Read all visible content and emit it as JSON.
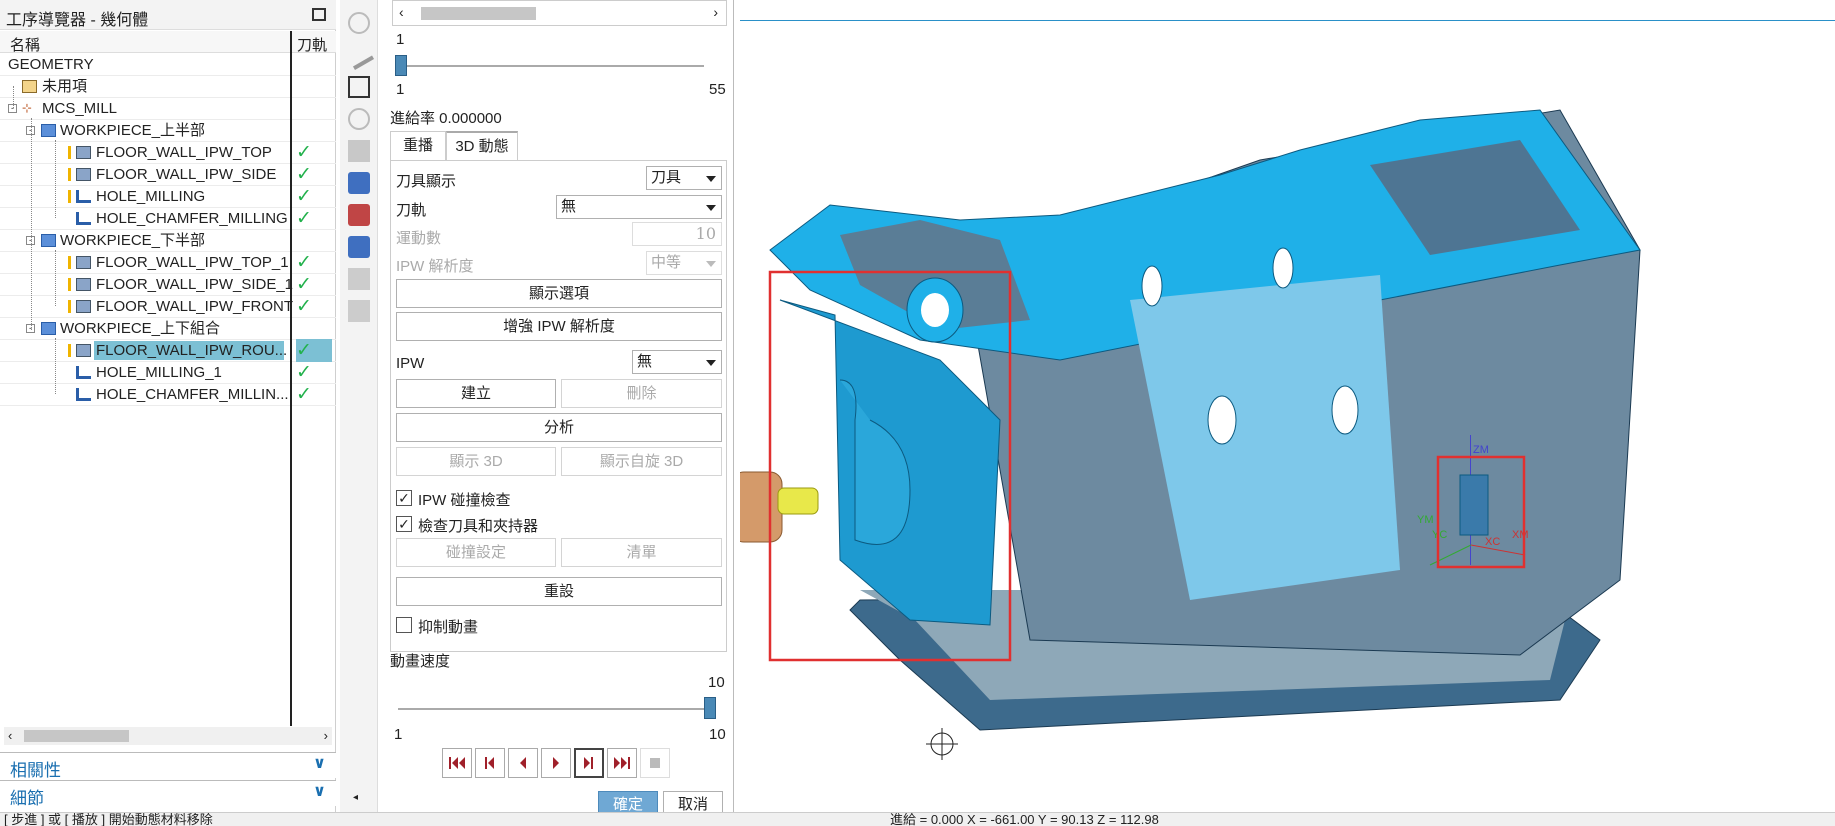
{
  "navigator": {
    "title": "工序導覽器 - 幾何體",
    "col_name": "名稱",
    "col_path": "刀軌",
    "rows": [
      {
        "label": "GEOMETRY",
        "check": ""
      },
      {
        "label": "未用項",
        "check": ""
      },
      {
        "label": "MCS_MILL",
        "check": ""
      },
      {
        "label": "WORKPIECE_上半部",
        "check": ""
      },
      {
        "label": "FLOOR_WALL_IPW_TOP",
        "check": "✓"
      },
      {
        "label": "FLOOR_WALL_IPW_SIDE",
        "check": "✓"
      },
      {
        "label": "HOLE_MILLING",
        "check": "✓"
      },
      {
        "label": "HOLE_CHAMFER_MILLING",
        "check": "✓"
      },
      {
        "label": "WORKPIECE_下半部",
        "check": ""
      },
      {
        "label": "FLOOR_WALL_IPW_TOP_1",
        "check": "✓"
      },
      {
        "label": "FLOOR_WALL_IPW_SIDE_1",
        "check": "✓"
      },
      {
        "label": "FLOOR_WALL_IPW_FRONT",
        "check": "✓"
      },
      {
        "label": "WORKPIECE_上下組合",
        "check": ""
      },
      {
        "label": "FLOOR_WALL_IPW_ROU...",
        "check": "✓"
      },
      {
        "label": "HOLE_MILLING_1",
        "check": "✓"
      },
      {
        "label": "HOLE_CHAMFER_MILLIN...",
        "check": "✓"
      }
    ],
    "sections": [
      "相關性",
      "細節"
    ]
  },
  "dialog": {
    "slider1": {
      "value": "1",
      "min": "1",
      "max": "55",
      "position": 0.0
    },
    "feed_label": "進給率 0.000000",
    "tabs": [
      "重播",
      "3D 動態"
    ],
    "tool_display_label": "刀具顯示",
    "tool_display_value": "刀具",
    "toolpath_label": "刀軌",
    "toolpath_value": "無",
    "motion_count_label": "運動數",
    "motion_count_value": "10",
    "ipw_res_label": "IPW 解析度",
    "ipw_res_value": "中等",
    "display_options": "顯示選項",
    "enhance_ipw": "增強 IPW 解析度",
    "ipw_label": "IPW",
    "ipw_value": "無",
    "create": "建立",
    "delete": "刪除",
    "analyze": "分析",
    "show_3d": "顯示 3D",
    "show_rotate_3d": "顯示自旋 3D",
    "ipw_collision": "IPW 碰撞檢查",
    "check_tool_holder": "檢查刀具和夾持器",
    "collision_settings": "碰撞設定",
    "list": "清單",
    "reset": "重設",
    "suppress_anim": "抑制動畫",
    "anim_speed_label": "動畫速度",
    "slider2": {
      "value": "10",
      "min": "1",
      "max": "10",
      "position": 1.0
    },
    "ok": "確定",
    "cancel": "取消"
  },
  "viewport": {
    "axes": [
      "ZM",
      "ZC",
      "YM",
      "YC",
      "XC",
      "XM"
    ],
    "model_color": "#1aa7de",
    "highlight_color": "#e03030"
  },
  "status": {
    "left": "[ 步進 ] 或 [ 播放 ] 開始動態材料移除",
    "right": "進給 = 0.000  X = -661.00  Y = 90.13  Z = 112.98"
  }
}
